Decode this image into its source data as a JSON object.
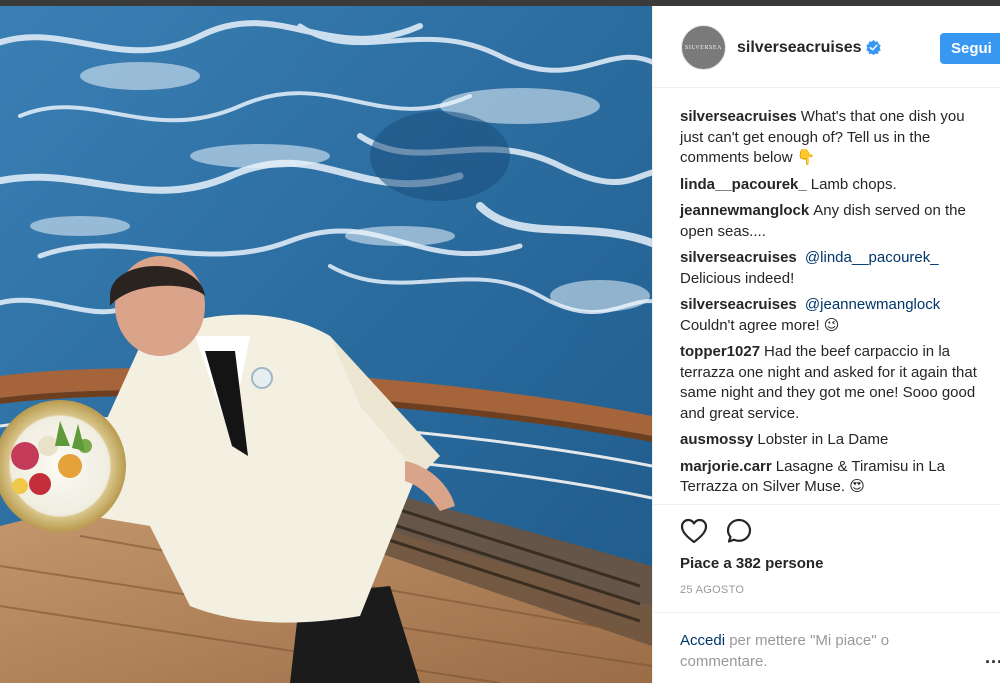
{
  "colors": {
    "accent": "#3897f0",
    "link": "#003569",
    "muted": "#999999",
    "text": "#262626"
  },
  "post": {
    "image_description_icon": "photo-waiter-at-sea"
  },
  "header": {
    "avatar_text": "SILVERSEA",
    "username": "silverseacruises",
    "verified_icon": "verified-badge-icon",
    "follow_label": "Segui"
  },
  "comments": [
    {
      "user": "silverseacruises",
      "text": "What's that one dish you just can't get enough of? Tell us in the comments below 👇"
    },
    {
      "user": "linda__pacourek_",
      "text": "Lamb chops."
    },
    {
      "user": "jeannewmanglock",
      "text": "Any dish served on the open seas...."
    },
    {
      "user": "silverseacruises",
      "mention": "@linda__pacourek_",
      "text": "Delicious indeed!"
    },
    {
      "user": "silverseacruises",
      "mention": "@jeannewmanglock",
      "text": "Couldn't agree more! 😉"
    },
    {
      "user": "topper1027",
      "text": "Had the beef carpaccio in la terrazza one night and asked for it again that same night and they got me one! Sooo good and great service."
    },
    {
      "user": "ausmossy",
      "text": "Lobster in La Dame"
    },
    {
      "user": "marjorie.carr",
      "text": "Lasagne & Tiramisu in La Terrazza on Silver Muse. 😍"
    }
  ],
  "actions": {
    "like_icon": "heart-icon",
    "comment_icon": "comment-bubble-icon",
    "likes_text": "Piace a 382 persone",
    "date_text": "25 AGOSTO"
  },
  "footer": {
    "login_link": "Accedi",
    "login_rest": " per mettere \"Mi piace\" o commentare.",
    "more_icon": "more-options-icon",
    "more_text": "..."
  }
}
